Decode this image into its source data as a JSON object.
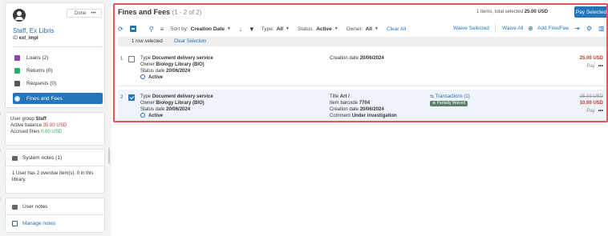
{
  "user": {
    "name": "Staff, Ex Libris",
    "id_label": "ID",
    "id_value": "exl_impl",
    "done_label": "Done",
    "more_label": "•••"
  },
  "nav": {
    "items": [
      {
        "label": "Loans (2)"
      },
      {
        "label": "Returns (0)"
      },
      {
        "label": "Requests (0)"
      },
      {
        "label": "Fines and Fees"
      }
    ]
  },
  "balance": {
    "group_label": "User group",
    "group_value": "Staff",
    "active_label": "Active balance",
    "active_value": "35.00 USD",
    "accrued_label": "Accrued fines",
    "accrued_value": "0.00 USD"
  },
  "system_notes": {
    "title": "System notes (1)",
    "text": "1 User has 2 overdue item(s). 0 in this library."
  },
  "user_notes": {
    "title": "User notes",
    "manage": "Manage notes"
  },
  "main": {
    "title": "Fines and Fees",
    "count": "(1 - 2 of 2)",
    "selection_summary_prefix": "1 items, total selected",
    "selection_summary_value": "25.00 USD",
    "pay_selected": "Pay Selected",
    "toolbar": {
      "sort_label": "Sort by:",
      "sort_value": "Creation Date",
      "type_label": "Type:",
      "type_value": "All",
      "status_label": "Status:",
      "status_value": "Active",
      "owner_label": "Owner:",
      "owner_value": "All",
      "clear_all": "Clear All",
      "waive_selected": "Waive Selected",
      "waive_all": "Waive All",
      "add_fine": "Add Fine/Fee"
    },
    "selbar": {
      "text": "1 row selected",
      "clear": "Clear Selection"
    }
  },
  "rows": [
    {
      "num": "1",
      "type_label": "Type",
      "type_value": "Document delivery service",
      "owner_label": "Owner",
      "owner_value": "Biology Library (BIO)",
      "status_date_label": "Status date",
      "status_date_value": "20/06/2024",
      "status": "Active",
      "creation_label": "Creation date",
      "creation_value": "20/06/2024",
      "amount": "25.00 USD",
      "pay": "Pay",
      "more": "•••"
    },
    {
      "num": "2",
      "type_label": "Type",
      "type_value": "Document delivery service",
      "owner_label": "Owner",
      "owner_value": "Biology Library (BIO)",
      "status_date_label": "Status date",
      "status_date_value": "20/06/2024",
      "status": "Active",
      "title_label": "Title",
      "title_value": "Art /",
      "barcode_label": "Item barcode",
      "barcode_value": "7704",
      "creation_label": "Creation date",
      "creation_value": "20/06/2024",
      "comment_label": "Comment",
      "comment_value": "Under investigation",
      "transactions": "Transactions (1)",
      "badge": "Partially Waived",
      "original_amount": "25.00 USD",
      "amount": "10.00 USD",
      "pay": "Pay",
      "more": "•••"
    }
  ]
}
